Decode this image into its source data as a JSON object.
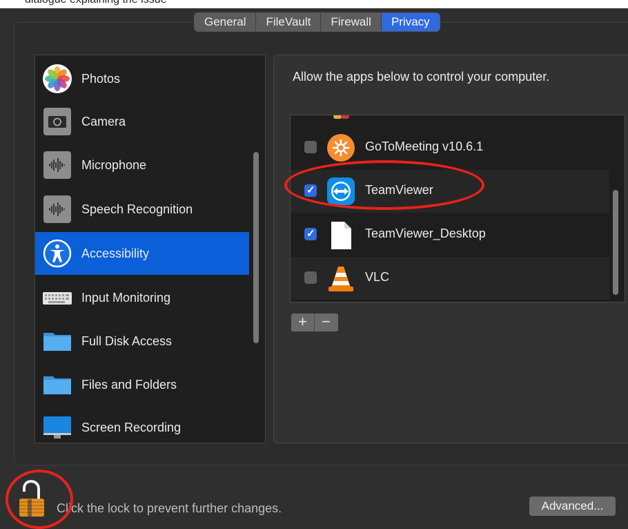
{
  "header_strip_text": "dialogue explaining the issue",
  "tabs": [
    {
      "label": "General",
      "active": false
    },
    {
      "label": "FileVault",
      "active": false
    },
    {
      "label": "Firewall",
      "active": false
    },
    {
      "label": "Privacy",
      "active": true
    }
  ],
  "sidebar": {
    "items": [
      {
        "label": "Photos",
        "icon": "photos-icon",
        "selected": false
      },
      {
        "label": "Camera",
        "icon": "camera-icon",
        "selected": false
      },
      {
        "label": "Microphone",
        "icon": "microphone-icon",
        "selected": false
      },
      {
        "label": "Speech Recognition",
        "icon": "speech-recognition-icon",
        "selected": false
      },
      {
        "label": "Accessibility",
        "icon": "accessibility-icon",
        "selected": true
      },
      {
        "label": "Input Monitoring",
        "icon": "keyboard-icon",
        "selected": false
      },
      {
        "label": "Full Disk Access",
        "icon": "folder-icon",
        "selected": false
      },
      {
        "label": "Files and Folders",
        "icon": "folder-icon",
        "selected": false
      },
      {
        "label": "Screen Recording",
        "icon": "monitor-icon",
        "selected": false
      }
    ]
  },
  "main": {
    "heading": "Allow the apps below to control your computer.",
    "apps": [
      {
        "name": "GoToMeeting v10.6.1",
        "checked": false,
        "icon": "gotomeeting-icon"
      },
      {
        "name": "TeamViewer",
        "checked": true,
        "icon": "teamviewer-icon"
      },
      {
        "name": "TeamViewer_Desktop",
        "checked": true,
        "icon": "document-icon"
      },
      {
        "name": "VLC",
        "checked": false,
        "icon": "vlc-cone-icon"
      }
    ],
    "add_label": "+",
    "remove_label": "−"
  },
  "footer": {
    "lock_text": "Click the lock to prevent further changes.",
    "advanced_label": "Advanced..."
  },
  "colors": {
    "accent": "#2f6ae0",
    "selection": "#0b5fd8",
    "annotation": "#e8221a"
  }
}
